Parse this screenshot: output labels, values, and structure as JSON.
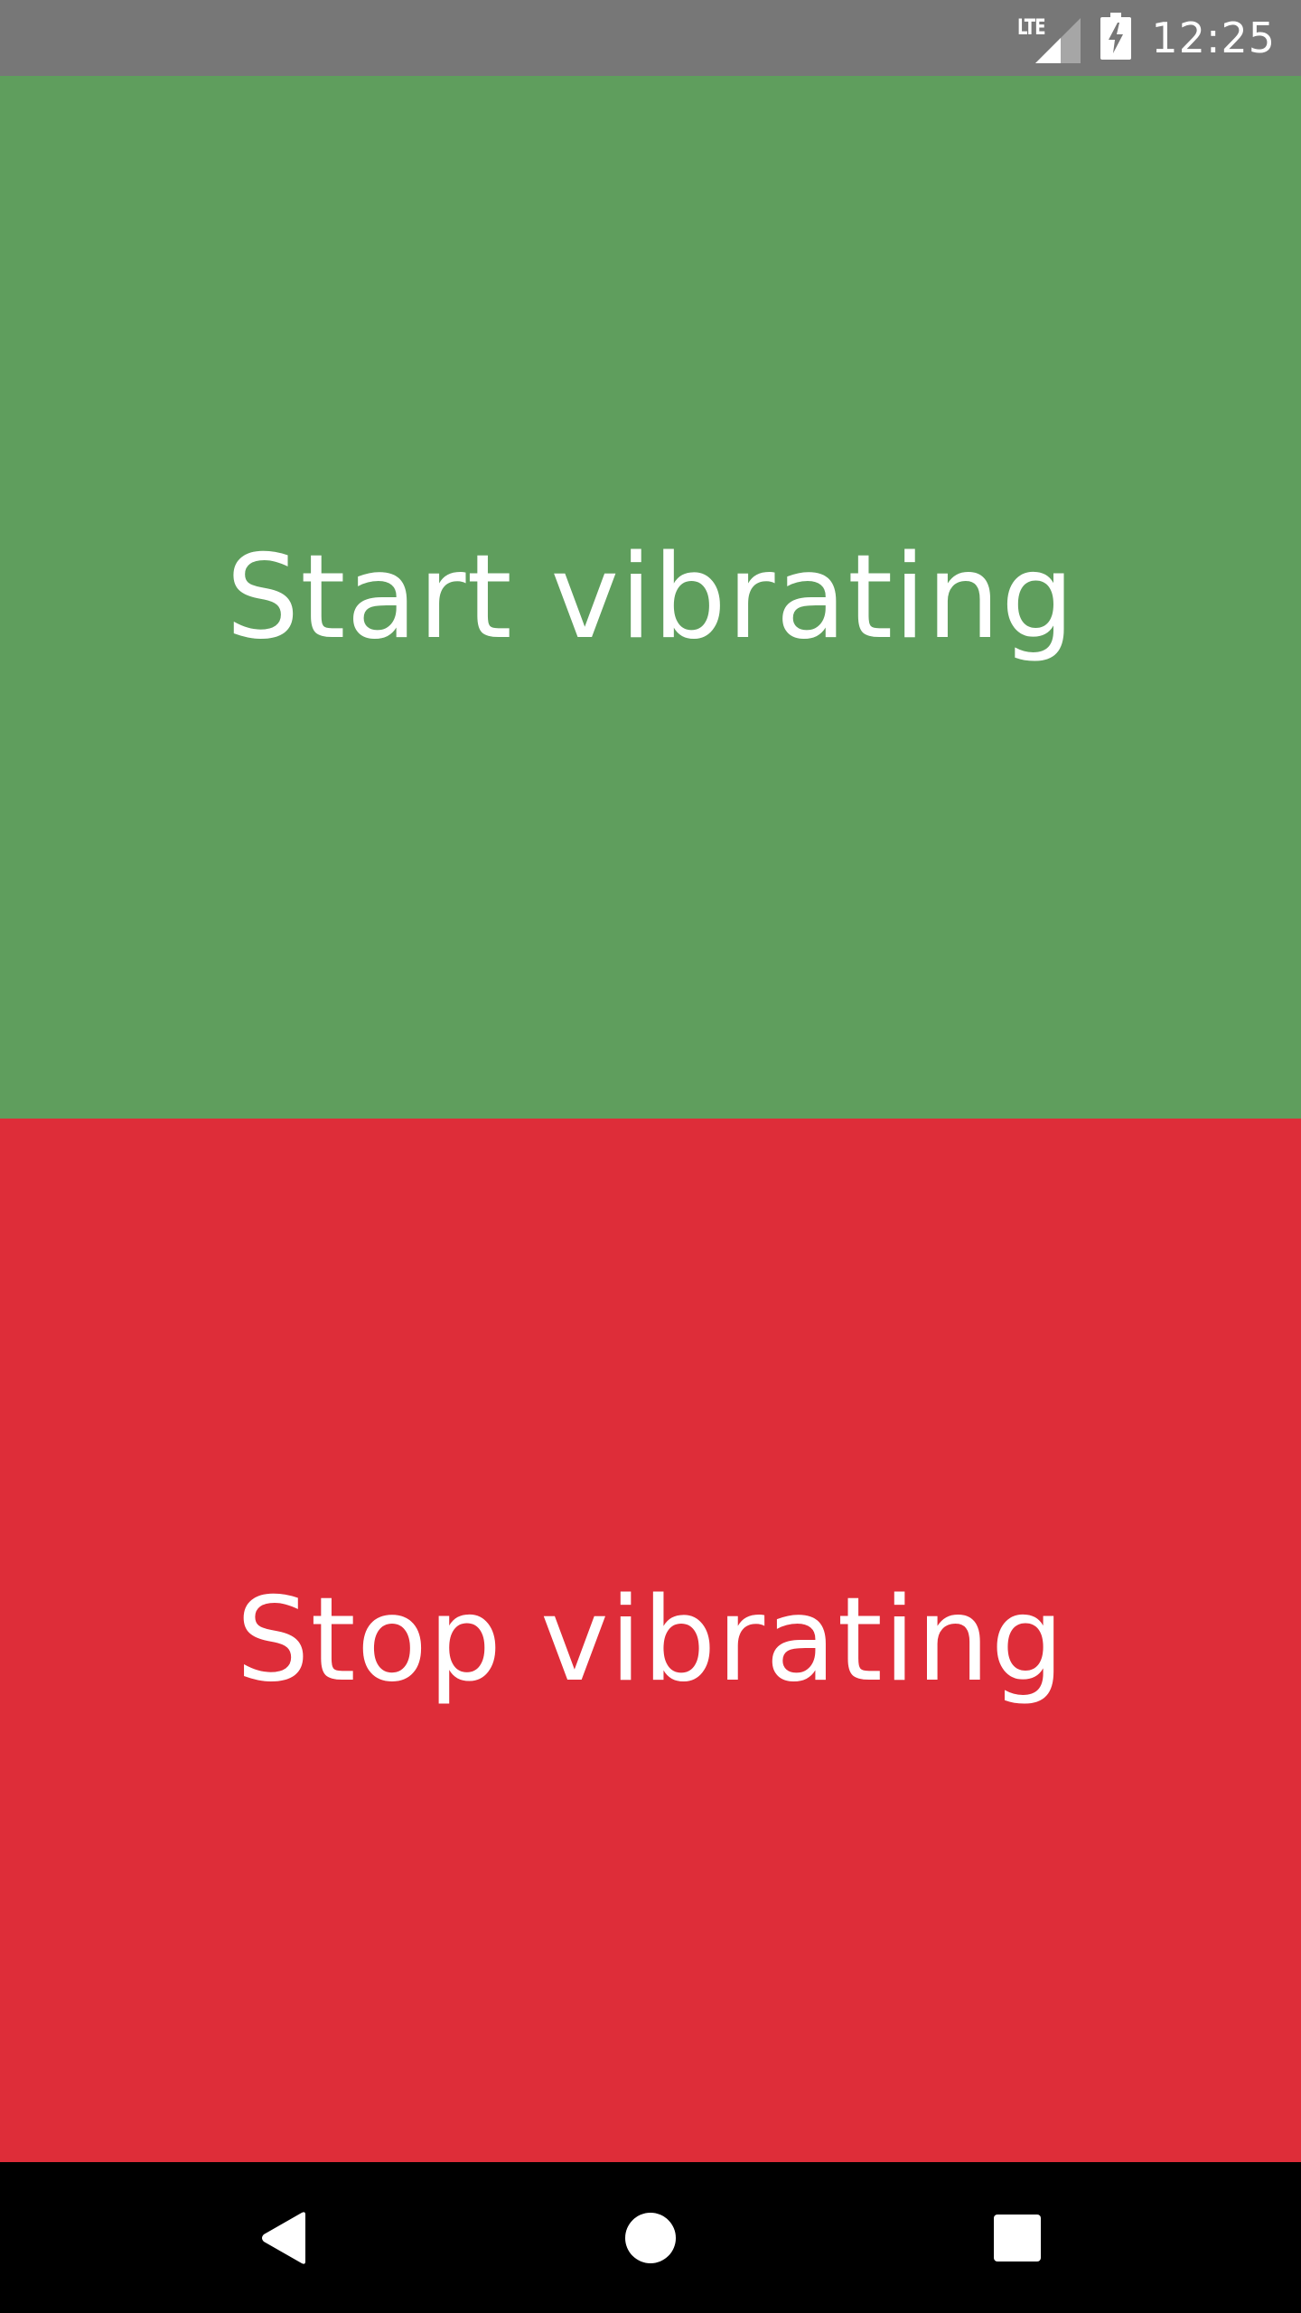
{
  "status_bar": {
    "network_label": "LTE",
    "time": "12:25",
    "icons": [
      "lte-signal-icon",
      "battery-charging-icon"
    ]
  },
  "panels": {
    "start": {
      "label": "Start vibrating",
      "color": "#5f9e5d"
    },
    "stop": {
      "label": "Stop vibrating",
      "color": "#de2d39"
    }
  },
  "nav_bar": {
    "icons": [
      "back-icon",
      "home-icon",
      "recents-icon"
    ]
  }
}
